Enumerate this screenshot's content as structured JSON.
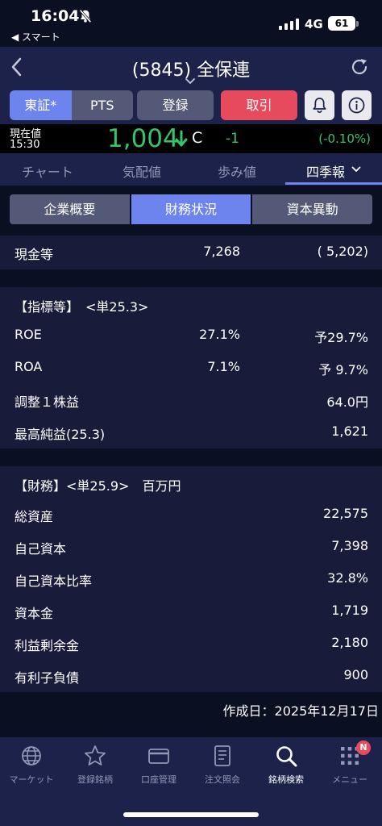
{
  "status_bar": {
    "time": "16:04",
    "back_app": "◀ スマート",
    "network": "4G",
    "battery": "61"
  },
  "nav": {
    "title": "(5845) 全保連"
  },
  "buttons": {
    "market_primary": "東証*",
    "market_pts": "PTS",
    "register": "登録",
    "trade": "取引"
  },
  "price": {
    "label_line1": "現在値",
    "label_line2": "15:30",
    "value": "1,004",
    "mark": "C",
    "change": "-1",
    "change_pct": "(-0.10%)"
  },
  "tabs": [
    "チャート",
    "気配値",
    "歩み値",
    "四季報"
  ],
  "sub_tabs": [
    "企業概要",
    "財務状況",
    "資本異動"
  ],
  "cash": {
    "label": "現金等",
    "value1": "7,268",
    "value2": "( 5,202)"
  },
  "indicators": {
    "header": "【指標等】　<単25.3>",
    "rows": [
      {
        "label": "ROE",
        "value1": "27.1%",
        "value2": "予29.7%"
      },
      {
        "label": "ROA",
        "value1": "7.1%",
        "value2": "予 9.7%"
      },
      {
        "label": "調整１株益",
        "value1": "",
        "value2": "64.0円"
      },
      {
        "label": "最高純益(25.3)",
        "value1": "",
        "value2": "1,621"
      }
    ]
  },
  "financials": {
    "header": "【財務】<単25.9>　百万円",
    "rows": [
      {
        "label": "総資産",
        "value": "22,575"
      },
      {
        "label": "自己資本",
        "value": "7,398"
      },
      {
        "label": "自己資本比率",
        "value": "32.8%"
      },
      {
        "label": "資本金",
        "value": "1,719"
      },
      {
        "label": "利益剰余金",
        "value": "2,180"
      },
      {
        "label": "有利子負債",
        "value": "900"
      }
    ]
  },
  "created_date": "作成日：2025年12月17日",
  "bottom_nav": [
    {
      "label": "マーケット",
      "icon": "globe-icon"
    },
    {
      "label": "登録銘柄",
      "icon": "star-icon"
    },
    {
      "label": "口座管理",
      "icon": "card-icon"
    },
    {
      "label": "注文照会",
      "icon": "document-icon"
    },
    {
      "label": "銘柄検索",
      "icon": "search-icon"
    },
    {
      "label": "メニュー",
      "icon": "grid-menu-icon"
    }
  ],
  "menu_badge": "N",
  "colors": {
    "background": "#0b0f22",
    "panel": "#181c3a",
    "accent": "#6d84ee",
    "trade": "#e84a5d",
    "price_down": "#34c46b"
  }
}
